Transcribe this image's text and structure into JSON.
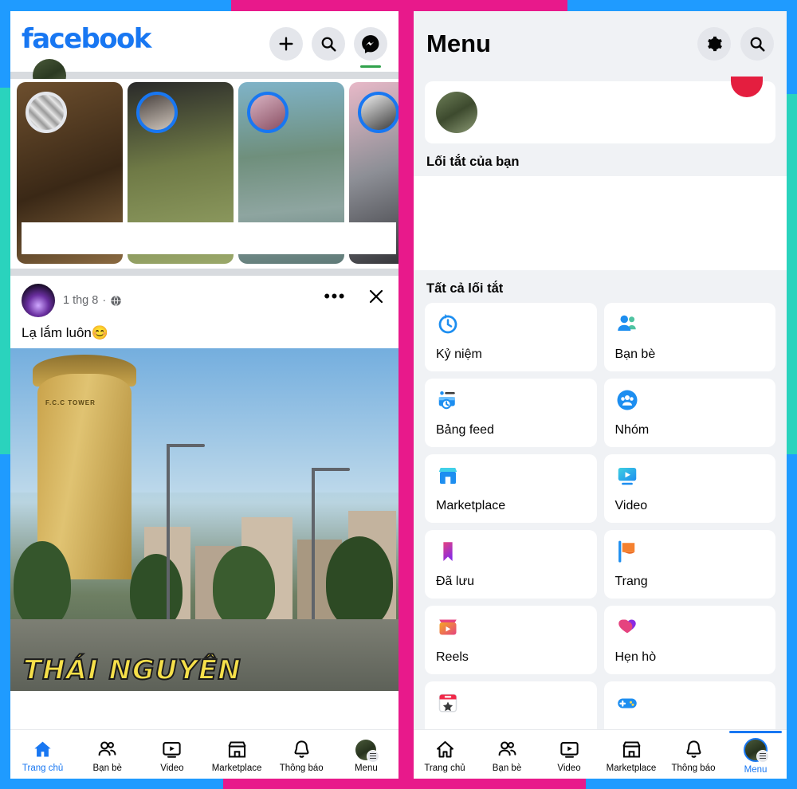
{
  "frame": {
    "blue": "#1f9bff",
    "pink": "#e8198b",
    "teal": "#2ad3bd"
  },
  "left_panel": {
    "header": {
      "logo_text": "facebook",
      "logo_color": "#1877f2",
      "actions": [
        {
          "name": "create-button",
          "icon": "plus-icon"
        },
        {
          "name": "search-button",
          "icon": "search-icon"
        },
        {
          "name": "messenger-button",
          "icon": "messenger-icon"
        }
      ]
    },
    "stories": [
      {
        "name": "story-1",
        "seen": true
      },
      {
        "name": "story-2",
        "seen": false
      },
      {
        "name": "story-3",
        "seen": false
      },
      {
        "name": "story-4",
        "seen": false
      }
    ],
    "post": {
      "timestamp": "1 thg 8",
      "separator": "·",
      "privacy_icon": "globe-icon",
      "text": "Lạ lắm luôn😊",
      "menu_icon": "more-options-icon",
      "close_icon": "close-icon",
      "photo_caption": "THÁI NGUYÊN",
      "photo_tower_label": "F.C.C TOWER"
    },
    "bottom_nav": {
      "active": "Trang chủ",
      "items": [
        {
          "label": "Trang chủ",
          "icon": "home-icon",
          "active": true
        },
        {
          "label": "Bạn bè",
          "icon": "friends-icon",
          "active": false
        },
        {
          "label": "Video",
          "icon": "video-icon",
          "active": false
        },
        {
          "label": "Marketplace",
          "icon": "marketplace-icon",
          "active": false
        },
        {
          "label": "Thông báo",
          "icon": "bell-icon",
          "active": false
        },
        {
          "label": "Menu",
          "icon": "menu-avatar-icon",
          "active": false
        }
      ]
    }
  },
  "right_panel": {
    "header": {
      "title": "Menu",
      "actions": [
        {
          "name": "settings-button",
          "icon": "gear-icon"
        },
        {
          "name": "search-button",
          "icon": "search-icon"
        }
      ]
    },
    "profile_card": {
      "badge_color": "#e41e3f"
    },
    "sections": {
      "your_shortcuts": "Lối tắt của bạn",
      "all_shortcuts": "Tất cả lối tắt"
    },
    "tiles": [
      {
        "label": "Kỷ niệm",
        "icon": "memories-clock-icon"
      },
      {
        "label": "Bạn bè",
        "icon": "friends-icon"
      },
      {
        "label": "Bảng feed",
        "icon": "feeds-icon"
      },
      {
        "label": "Nhóm",
        "icon": "groups-icon"
      },
      {
        "label": "Marketplace",
        "icon": "marketplace-icon"
      },
      {
        "label": "Video",
        "icon": "video-icon"
      },
      {
        "label": "Đã lưu",
        "icon": "saved-bookmark-icon"
      },
      {
        "label": "Trang",
        "icon": "pages-flag-icon"
      },
      {
        "label": "Reels",
        "icon": "reels-icon"
      },
      {
        "label": "Hẹn hò",
        "icon": "dating-heart-icon"
      },
      {
        "label": "",
        "icon": "events-calendar-icon"
      },
      {
        "label": "",
        "icon": "gaming-gamepad-icon"
      }
    ],
    "bottom_nav": {
      "active": "Menu",
      "items": [
        {
          "label": "Trang chủ",
          "icon": "home-icon",
          "active": false
        },
        {
          "label": "Bạn bè",
          "icon": "friends-icon",
          "active": false
        },
        {
          "label": "Video",
          "icon": "video-icon",
          "active": false
        },
        {
          "label": "Marketplace",
          "icon": "marketplace-icon",
          "active": false
        },
        {
          "label": "Thông báo",
          "icon": "bell-icon",
          "active": false
        },
        {
          "label": "Menu",
          "icon": "menu-avatar-icon",
          "active": true
        }
      ]
    }
  }
}
